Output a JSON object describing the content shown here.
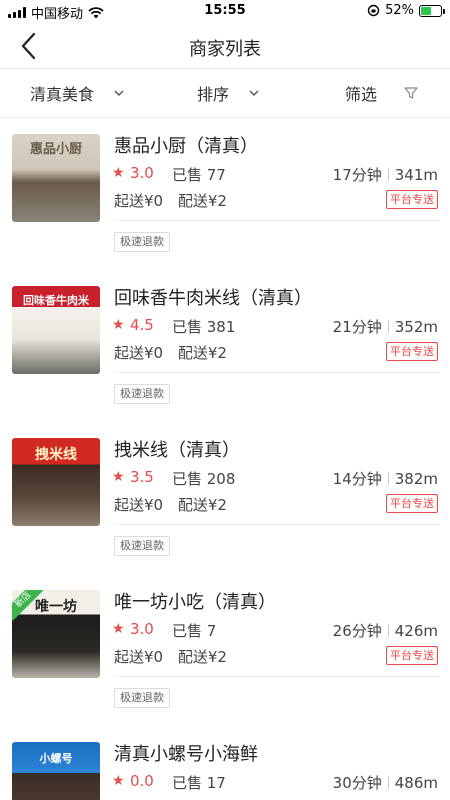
{
  "status_bar": {
    "carrier": "中国移动",
    "time": "15:55",
    "battery": "52%",
    "battery_level": 0.52
  },
  "nav": {
    "title": "商家列表"
  },
  "filters": {
    "category": "清真美食",
    "sort": "排序",
    "filter": "筛选"
  },
  "stores": [
    {
      "name": "惠品小厨（清真）",
      "rating": "3.0",
      "sold": "已售 77",
      "time": "17分钟",
      "distance": "341m",
      "min_order": "起送¥0",
      "delivery_fee": "配送¥2",
      "delivery_badge": "平台专送",
      "tag": "极速退款",
      "thumb_text": "惠品小厨"
    },
    {
      "name": "回味香牛肉米线（清真）",
      "rating": "4.5",
      "sold": "已售 381",
      "time": "21分钟",
      "distance": "352m",
      "min_order": "起送¥0",
      "delivery_fee": "配送¥2",
      "delivery_badge": "平台专送",
      "tag": "极速退款",
      "thumb_text": "回味香牛肉米"
    },
    {
      "name": "拽米线（清真）",
      "rating": "3.5",
      "sold": "已售 208",
      "time": "14分钟",
      "distance": "382m",
      "min_order": "起送¥0",
      "delivery_fee": "配送¥2",
      "delivery_badge": "平台专送",
      "tag": "极速退款",
      "thumb_text": "拽米线"
    },
    {
      "name": "唯一坊小吃（清真）",
      "rating": "3.0",
      "sold": "已售 7",
      "time": "26分钟",
      "distance": "426m",
      "min_order": "起送¥0",
      "delivery_fee": "配送¥2",
      "delivery_badge": "平台专送",
      "tag": "极速退款",
      "thumb_text": "唯一坊",
      "new_tag": "新店"
    },
    {
      "name": "清真小螺号小海鲜",
      "rating": "0.0",
      "sold": "已售 17",
      "time": "30分钟",
      "distance": "486m",
      "thumb_text": "小螺号"
    }
  ],
  "icons": {
    "back": "chevron-left-icon",
    "dropdown": "chevron-down-icon",
    "filter": "funnel-icon",
    "star": "star-icon",
    "wifi": "wifi-icon",
    "battery": "battery-icon"
  },
  "colors": {
    "accent": "#e84b4b",
    "battery": "#2ec84a",
    "new_tag": "#3bb54a"
  }
}
